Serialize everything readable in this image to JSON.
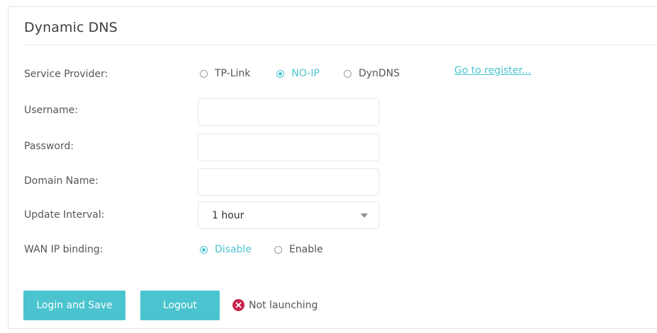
{
  "section": {
    "title": "Dynamic DNS"
  },
  "service_provider": {
    "label": "Service Provider:",
    "options": [
      "TP-Link",
      "NO-IP",
      "DynDNS"
    ],
    "selected": "NO-IP",
    "register_link": "Go to register..."
  },
  "username": {
    "label": "Username:",
    "value": ""
  },
  "password": {
    "label": "Password:",
    "value": ""
  },
  "domain_name": {
    "label": "Domain Name:",
    "value": ""
  },
  "update_interval": {
    "label": "Update Interval:",
    "value": "1 hour"
  },
  "wan_ip_binding": {
    "label": "WAN IP binding:",
    "options": [
      "Disable",
      "Enable"
    ],
    "selected": "Disable"
  },
  "actions": {
    "login_save_label": "Login and Save",
    "logout_label": "Logout",
    "status_text": "Not launching"
  },
  "colors": {
    "accent": "#4bc4cf",
    "error": "#c7264f"
  },
  "icons": {
    "status": "error-x-icon",
    "dropdown": "chevron-down-icon"
  }
}
